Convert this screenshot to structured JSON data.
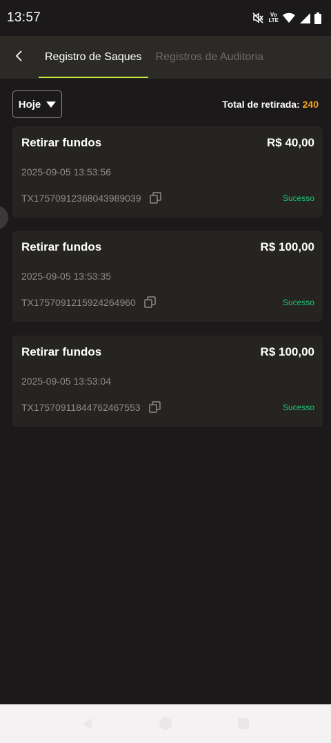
{
  "status_bar": {
    "time": "13:57",
    "icons": [
      "mute-icon",
      "volte-icon",
      "wifi-icon",
      "signal-icon",
      "battery-icon"
    ],
    "volte_top": "Vo",
    "volte_bottom": "LTE"
  },
  "header": {
    "back_icon": "chevron-left-icon",
    "tabs": [
      {
        "label": "Registro de Saques",
        "active": true
      },
      {
        "label": "Registros de Auditoria",
        "active": false
      }
    ],
    "accent_color": "#c6e83a"
  },
  "filter": {
    "selected": "Hoje",
    "total_label": "Total de retirada:",
    "total_value": "240",
    "total_color": "#f5a524"
  },
  "records": [
    {
      "title": "Retirar fundos",
      "amount": "R$ 40,00",
      "date": "2025-09-05 13:53:56",
      "tx": "TX17570912368043989039",
      "status": "Sucesso"
    },
    {
      "title": "Retirar fundos",
      "amount": "R$ 100,00",
      "date": "2025-09-05 13:53:35",
      "tx": "TX1757091215924264960",
      "status": "Sucesso"
    },
    {
      "title": "Retirar fundos",
      "amount": "R$ 100,00",
      "date": "2025-09-05 13:53:04",
      "tx": "TX17570911844762467553",
      "status": "Sucesso"
    }
  ],
  "status_color": "#1fca7a",
  "nav_bar": {
    "icons": [
      "back-triangle-icon",
      "home-circle-icon",
      "recents-square-icon"
    ]
  }
}
